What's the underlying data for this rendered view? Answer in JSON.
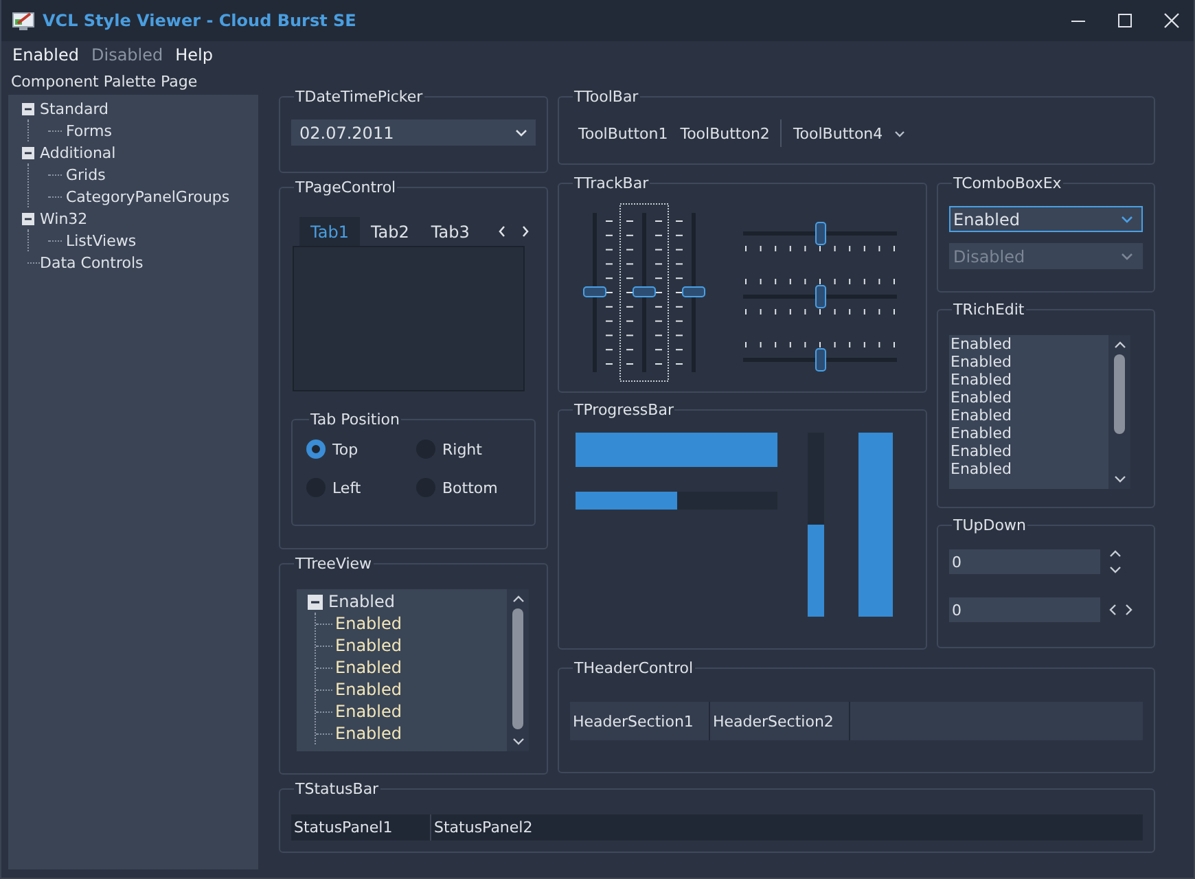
{
  "window": {
    "title": "VCL Style Viewer - Cloud Burst SE"
  },
  "menu": [
    {
      "label": "Enabled",
      "disabled": false
    },
    {
      "label": "Disabled",
      "disabled": true
    },
    {
      "label": "Help",
      "disabled": false
    }
  ],
  "palette": {
    "label": "Component Palette Page",
    "tree": [
      {
        "label": "Standard",
        "expanded": true,
        "children": [
          {
            "label": "Forms"
          }
        ]
      },
      {
        "label": "Additional",
        "expanded": true,
        "children": [
          {
            "label": "Grids"
          },
          {
            "label": "CategoryPanelGroups"
          }
        ]
      },
      {
        "label": "Win32",
        "expanded": true,
        "children": [
          {
            "label": "ListViews"
          }
        ]
      },
      {
        "label": "Data Controls"
      }
    ]
  },
  "datetimepicker": {
    "title": "TDateTimePicker",
    "value": "02.07.2011"
  },
  "pagecontrol": {
    "title": "TPageControl",
    "tabs": [
      {
        "label": "Tab1",
        "selected": true
      },
      {
        "label": "Tab2",
        "selected": false
      },
      {
        "label": "Tab3",
        "selected": false
      }
    ],
    "tab_position": {
      "title": "Tab Position",
      "options": [
        {
          "label": "Top",
          "selected": true
        },
        {
          "label": "Right",
          "selected": false
        },
        {
          "label": "Left",
          "selected": false
        },
        {
          "label": "Bottom",
          "selected": false
        }
      ]
    }
  },
  "treeview": {
    "title": "TTreeView",
    "tree": [
      {
        "label": "Enabled",
        "expanded": true,
        "children": [
          {
            "label": "Enabled"
          },
          {
            "label": "Enabled"
          },
          {
            "label": "Enabled"
          },
          {
            "label": "Enabled"
          },
          {
            "label": "Enabled"
          },
          {
            "label": "Enabled"
          }
        ]
      }
    ]
  },
  "toolbar": {
    "title": "TToolBar",
    "items": [
      {
        "kind": "button",
        "label": "ToolButton1"
      },
      {
        "kind": "button",
        "label": "ToolButton2"
      },
      {
        "kind": "separator"
      },
      {
        "kind": "dropdown",
        "label": "ToolButton4"
      }
    ]
  },
  "trackbar": {
    "title": "TTrackBar",
    "vertical": [
      {
        "level": 0.5,
        "kind": "right",
        "focused": false
      },
      {
        "level": 0.5,
        "kind": "both",
        "focused": true
      },
      {
        "level": 0.5,
        "kind": "left",
        "focused": false
      }
    ],
    "horizontal": [
      {
        "level": 0.5,
        "kind": "bottom"
      },
      {
        "level": 0.5,
        "kind": "both"
      },
      {
        "level": 0.5,
        "kind": "top"
      }
    ]
  },
  "progressbar": {
    "title": "TProgressBar",
    "horizontal": [
      {
        "level": 1
      },
      {
        "level": 0.5
      }
    ],
    "vertical": [
      {
        "level": 0.5
      },
      {
        "level": 1
      }
    ]
  },
  "comboboxex": {
    "title": "TComboBoxEx",
    "items": [
      {
        "value": "Enabled",
        "disabled": false,
        "focused": true
      },
      {
        "value": "Disabled",
        "disabled": true,
        "focused": false
      }
    ]
  },
  "richedit": {
    "title": "TRichEdit",
    "lines": [
      "Enabled",
      "Enabled",
      "Enabled",
      "Enabled",
      "Enabled",
      "Enabled",
      "Enabled",
      "Enabled"
    ]
  },
  "updown": {
    "title": "TUpDown",
    "items": [
      {
        "value": "0",
        "kind": "vertical"
      },
      {
        "value": "0",
        "kind": "horizontal"
      }
    ]
  },
  "headercontrol": {
    "title": "THeaderControl",
    "sections": [
      "HeaderSection1",
      "HeaderSection2"
    ]
  },
  "statusbar": {
    "title": "TStatusBar",
    "panels": [
      "StatusPanel1",
      "StatusPanel2"
    ]
  }
}
